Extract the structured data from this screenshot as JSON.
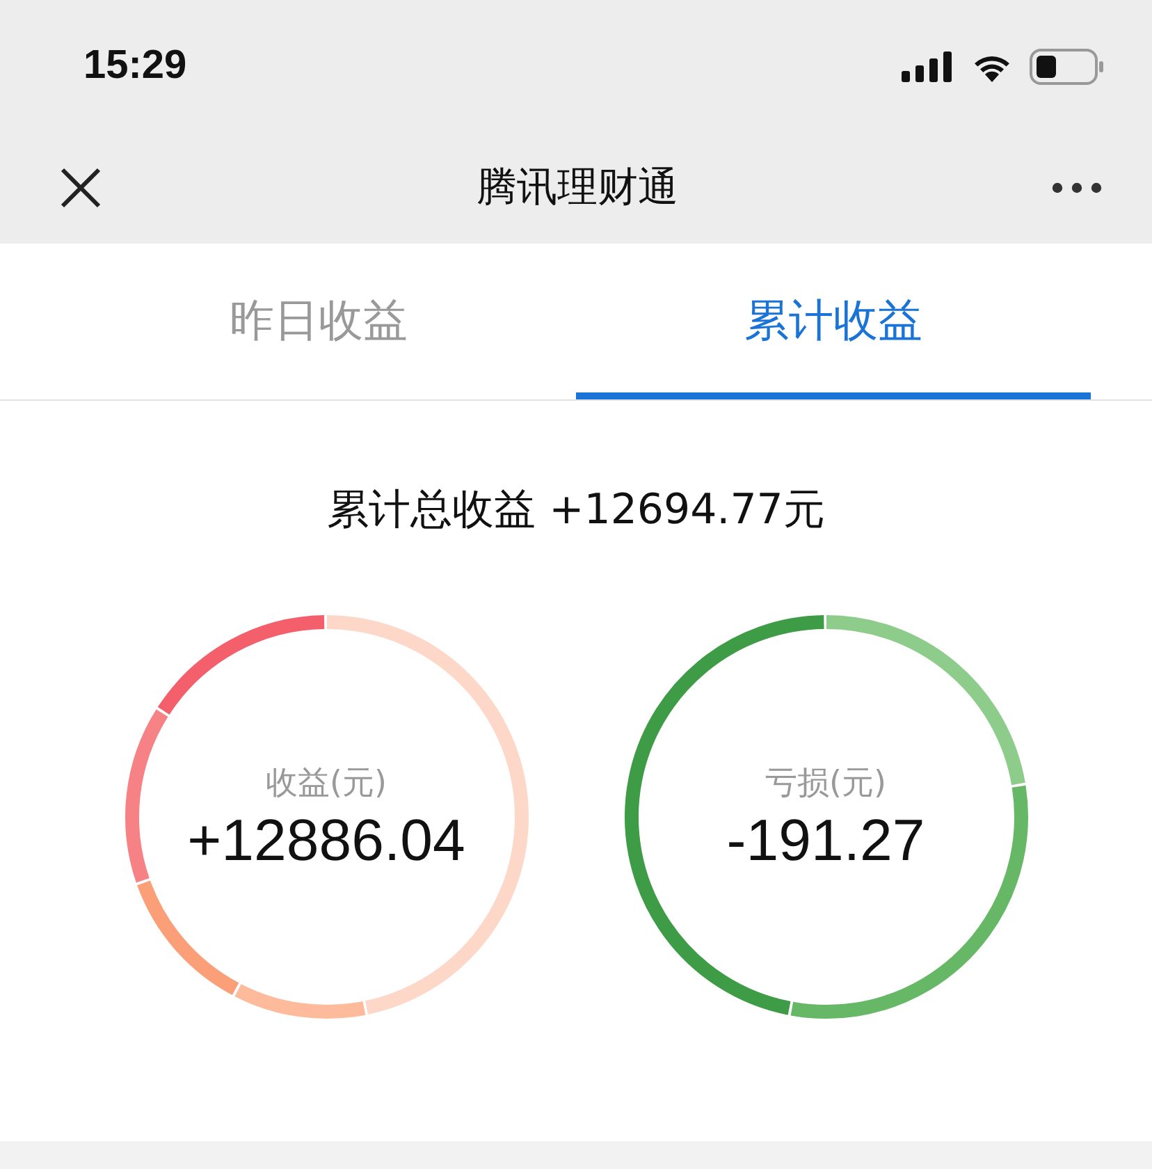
{
  "status_bar": {
    "time": "15:29"
  },
  "nav": {
    "title": "腾讯理财通"
  },
  "tabs": [
    {
      "label": "昨日收益",
      "selected": false
    },
    {
      "label": "累计收益",
      "selected": true
    }
  ],
  "summary": "累计总收益 +12694.77元",
  "rings": [
    {
      "kind": "gain",
      "label": "收益(元)",
      "value": "+12886.04"
    },
    {
      "kind": "loss",
      "label": "亏损(元)",
      "value": "-191.27"
    }
  ]
}
